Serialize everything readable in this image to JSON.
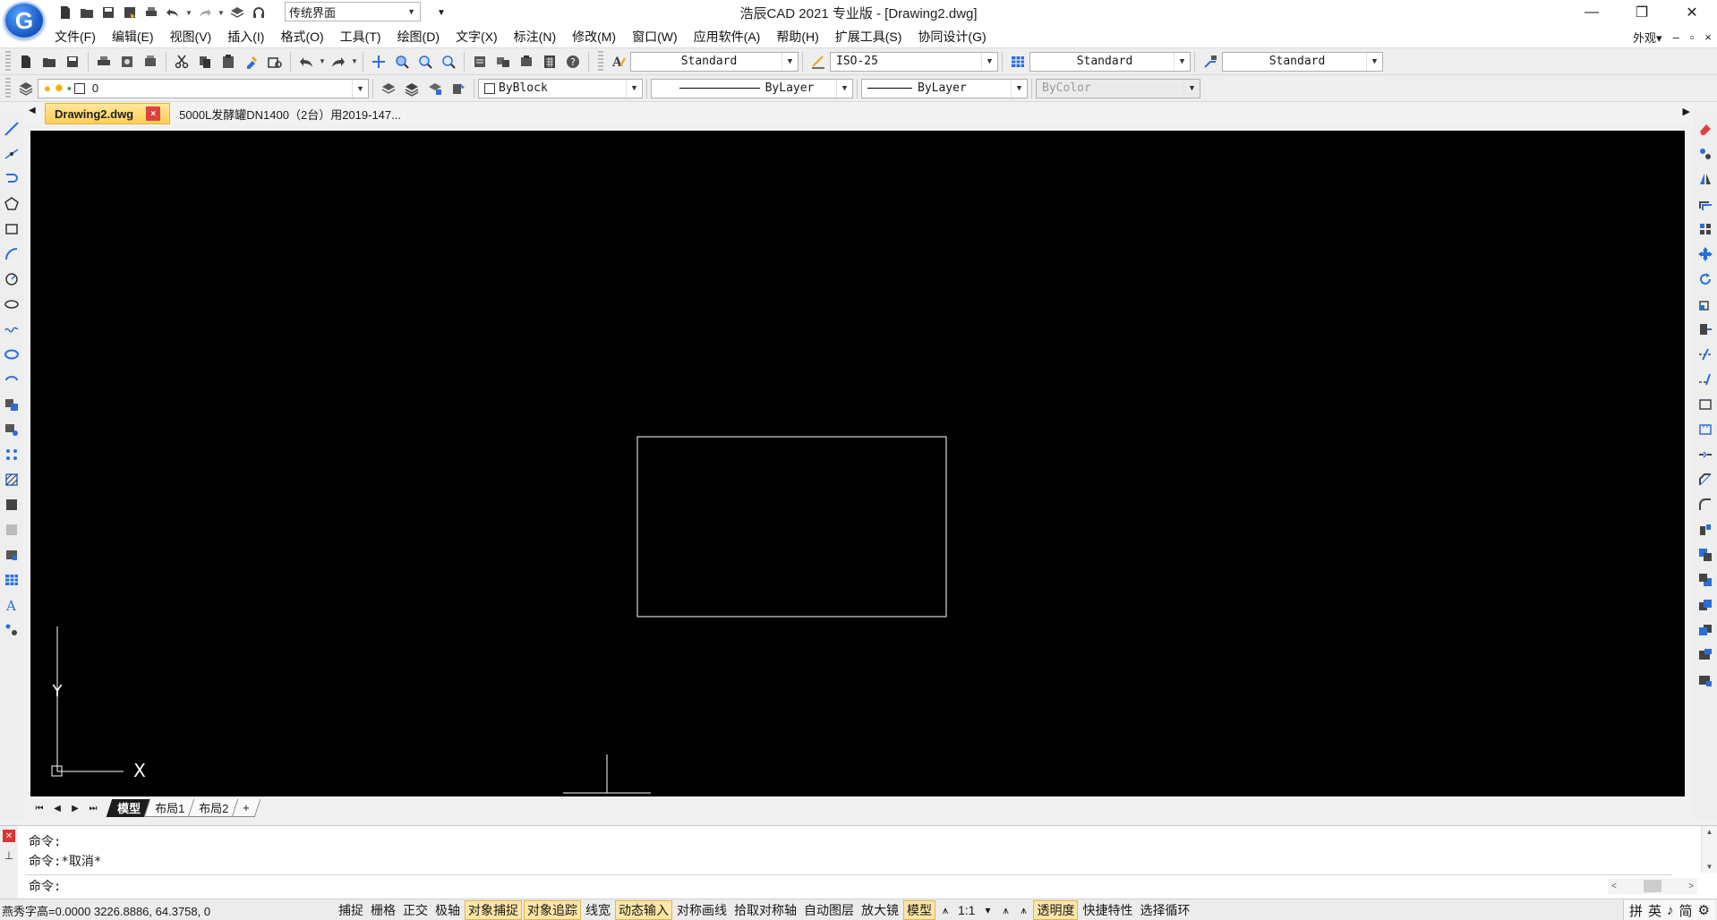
{
  "window": {
    "title": "浩辰CAD 2021 专业版 - [Drawing2.dwg]",
    "logo_letter": "G",
    "minimize": "—",
    "restore": "❐",
    "close": "✕"
  },
  "quick_access": {
    "workspace_value": "传统界面"
  },
  "menu": {
    "items": [
      "文件(F)",
      "编辑(E)",
      "视图(V)",
      "插入(I)",
      "格式(O)",
      "工具(T)",
      "绘图(D)",
      "文字(X)",
      "标注(N)",
      "修改(M)",
      "窗口(W)",
      "应用软件(A)",
      "帮助(H)",
      "扩展工具(S)",
      "协同设计(G)"
    ],
    "appearance": "外观▾",
    "mdi_min": "–",
    "mdi_restore": "▫",
    "mdi_close": "×"
  },
  "toolbar1": {
    "text_style": "Standard",
    "dim_style": "ISO-25",
    "table_style": "Standard",
    "mleader_style": "Standard"
  },
  "toolbar2": {
    "layer": "0",
    "color": "ByBlock",
    "linetype": "ByLayer",
    "lineweight": "ByLayer",
    "plot_style": "ByColor"
  },
  "doc_tabs": [
    {
      "label": "Drawing2.dwg",
      "active": true,
      "close": "×"
    },
    {
      "label": "5000L发酵罐DN1400（2台）用2019-147...",
      "active": false
    }
  ],
  "canvas": {
    "background": "#000000",
    "ucs_y_label": "Y",
    "ucs_x_label": "X"
  },
  "layout_tabs": {
    "items": [
      "模型",
      "布局1",
      "布局2",
      "+"
    ],
    "active": "模型"
  },
  "command": {
    "history": [
      "命令:",
      "命令:*取消*"
    ],
    "prompt": "命令:"
  },
  "status": {
    "coords": "燕秀字高=0.0000  3226.8886, 64.3758, 0",
    "toggles": [
      {
        "label": "捕捉",
        "on": false
      },
      {
        "label": "栅格",
        "on": false
      },
      {
        "label": "正交",
        "on": false
      },
      {
        "label": "极轴",
        "on": false
      },
      {
        "label": "对象捕捉",
        "on": true
      },
      {
        "label": "对象追踪",
        "on": true
      },
      {
        "label": "线宽",
        "on": false
      },
      {
        "label": "动态输入",
        "on": true
      },
      {
        "label": "对称画线",
        "on": false
      },
      {
        "label": "拾取对称轴",
        "on": false
      },
      {
        "label": "自动图层",
        "on": false
      },
      {
        "label": "放大镜",
        "on": false
      },
      {
        "label": "模型",
        "on": true
      }
    ],
    "scale": "1:1",
    "transparency": "透明度",
    "quick_props": "快捷特性",
    "selection_cycle": "选择循环",
    "ime": [
      "拼",
      "英",
      "♪",
      "简",
      "⚙"
    ]
  },
  "colors": {
    "accent_tab": "#ffcf55",
    "status_on": "#fde6a6",
    "icon_blue": "#2b6fd6"
  }
}
